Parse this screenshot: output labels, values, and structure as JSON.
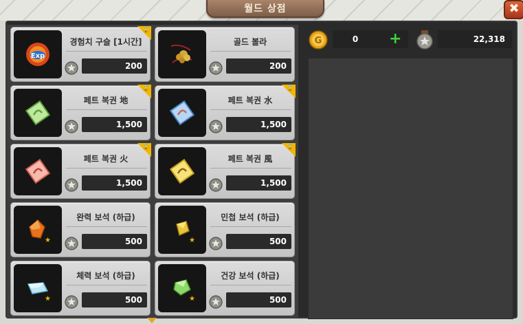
{
  "window": {
    "title": "월드 상점",
    "close_label": "✖"
  },
  "currency": {
    "gold": "0",
    "coin": "22,318"
  },
  "items": [
    {
      "name": "경험치 구슬 [1시간]",
      "price": "200",
      "icon": "exp-orb-icon",
      "locked": true
    },
    {
      "name": "골드 볼라",
      "price": "200",
      "icon": "gold-bola-icon",
      "locked": false
    },
    {
      "name": "페트 복권 地",
      "price": "1,500",
      "icon": "pet-ticket-earth-icon",
      "locked": true
    },
    {
      "name": "페트 복권 水",
      "price": "1,500",
      "icon": "pet-ticket-water-icon",
      "locked": true
    },
    {
      "name": "페트 복권 火",
      "price": "1,500",
      "icon": "pet-ticket-fire-icon",
      "locked": true
    },
    {
      "name": "페트 복권 風",
      "price": "1,500",
      "icon": "pet-ticket-wind-icon",
      "locked": true
    },
    {
      "name": "완력 보석 (하급)",
      "price": "500",
      "icon": "strength-gem-icon",
      "locked": false
    },
    {
      "name": "민첩 보석 (하급)",
      "price": "500",
      "icon": "agility-gem-icon",
      "locked": false
    },
    {
      "name": "체력 보석 (하급)",
      "price": "500",
      "icon": "vitality-gem-icon",
      "locked": false
    },
    {
      "name": "건강 보석 (하급)",
      "price": "500",
      "icon": "health-gem-icon",
      "locked": false
    }
  ],
  "colors": {
    "accent_gold": "#f1b600",
    "plus_green": "#3fd13a",
    "title_brown": "#7e5d48"
  }
}
